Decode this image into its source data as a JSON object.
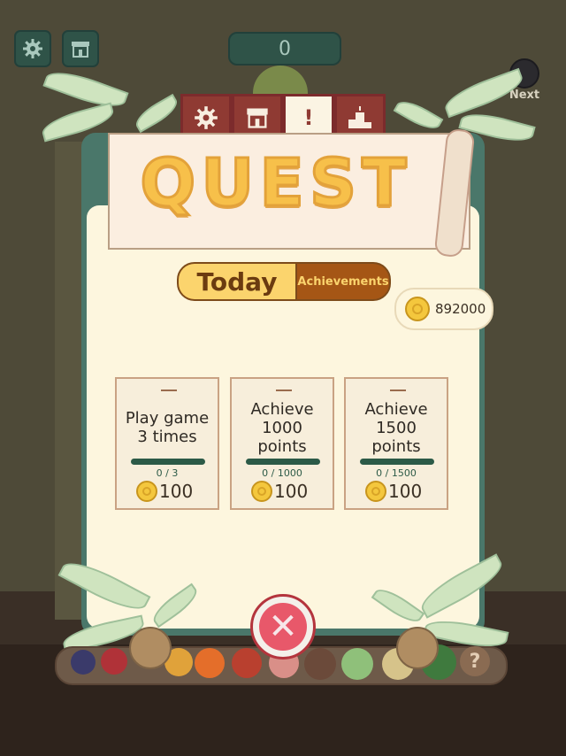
{
  "top_bar": {
    "settings_icon": "gear-icon",
    "shop_icon": "shop-icon",
    "score": "0",
    "next_label": "Next"
  },
  "tabs": [
    {
      "name": "settings",
      "icon": "gear-icon",
      "active": false
    },
    {
      "name": "shop",
      "icon": "shop-icon",
      "active": false
    },
    {
      "name": "quest",
      "icon": "exclamation-icon",
      "active": true,
      "glyph": "!"
    },
    {
      "name": "ranking",
      "icon": "podium-icon",
      "active": false
    }
  ],
  "title": "QUEST",
  "segments": {
    "today": "Today",
    "achievements": "Achievements"
  },
  "coins": {
    "balance": "892000"
  },
  "quests": [
    {
      "title": "Play game 3 times",
      "progress": "0 / 3",
      "reward": "100"
    },
    {
      "title": "Achieve 1000 points",
      "progress": "0 / 1000",
      "reward": "100"
    },
    {
      "title": "Achieve 1500 points",
      "progress": "0 / 1500",
      "reward": "100"
    }
  ],
  "close_icon": "close-icon",
  "fruit_rail": {
    "unknown_glyph": "?"
  },
  "colors": {
    "accent_yellow": "#fbd46d",
    "tab_red": "#8f3a33",
    "panel_cream": "#fdf6de",
    "close_red": "#e8586a",
    "teal_frame": "#4a776a"
  }
}
